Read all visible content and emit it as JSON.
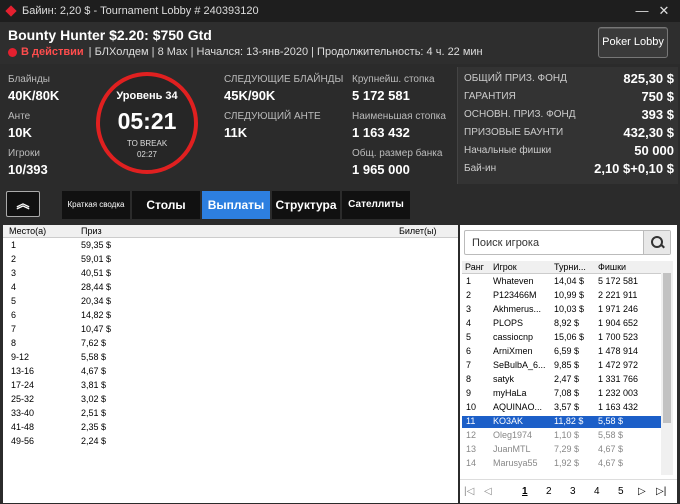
{
  "window": {
    "title": "Байин: 2,20 $ - Tournament Lobby # 240393120",
    "minimize": "—",
    "close": "✕"
  },
  "header": {
    "tournament_name": "Bounty Hunter $2.20: $750 Gtd",
    "status": "В действии",
    "info": "| БЛХолдем | 8 Max | Начался: 13-янв-2020 | Продолжительность: 4 ч. 22 мин",
    "poker_lobby_btn": "Poker Lobby"
  },
  "summary": {
    "blinds_label": "Блайнды",
    "blinds": "40K/80K",
    "ante_label": "Анте",
    "ante": "10K",
    "players_label": "Игроки",
    "players": "10/393",
    "next_blinds_label": "СЛЕДУЮЩИЕ БЛАЙНДЫ",
    "next_blinds": "45K/90K",
    "next_ante_label": "СЛЕДУЮЩИЙ АНТЕ",
    "next_ante": "11K",
    "largest_stack_label": "Крупнейш. стопка",
    "largest_stack": "5 172 581",
    "smallest_stack_label": "Наименьшая стопка",
    "smallest_stack": "1 163 432",
    "total_bank_label": "Общ. размер банка",
    "total_bank": "1 965 000"
  },
  "clock": {
    "level": "Уровень 34",
    "time": "05:21",
    "to_break": "TO BREAK",
    "break_time": "02:27"
  },
  "prize_panel": [
    {
      "label": "ОБЩИЙ ПРИЗ. ФОНД",
      "value": "825,30 $"
    },
    {
      "label": "ГАРАНТИЯ",
      "value": "750 $"
    },
    {
      "label": "ОСНОВН. ПРИЗ. ФОНД",
      "value": "393 $"
    },
    {
      "label": "ПРИЗОВЫЕ БАУНТИ",
      "value": "432,30 $"
    },
    {
      "label": "Начальные фишки",
      "value": "50 000"
    },
    {
      "label": "Бай-ин",
      "value": "2,10 $+0,10 $"
    }
  ],
  "tabs": {
    "collapse": "︽",
    "summary": "Краткая сводка",
    "tables": "Столы",
    "payouts": "Выплаты",
    "structure": "Структура",
    "satellites": "Сателлиты"
  },
  "payouts": {
    "headers": {
      "place": "Место(а)",
      "prize": "Приз",
      "ticket": "Билет(ы)"
    },
    "rows": [
      {
        "place": "1",
        "prize": "59,35 $"
      },
      {
        "place": "2",
        "prize": "59,01 $"
      },
      {
        "place": "3",
        "prize": "40,51 $"
      },
      {
        "place": "4",
        "prize": "28,44 $"
      },
      {
        "place": "5",
        "prize": "20,34 $"
      },
      {
        "place": "6",
        "prize": "14,82 $"
      },
      {
        "place": "7",
        "prize": "10,47 $"
      },
      {
        "place": "8",
        "prize": "7,62 $"
      },
      {
        "place": "9-12",
        "prize": "5,58 $"
      },
      {
        "place": "13-16",
        "prize": "4,67 $"
      },
      {
        "place": "17-24",
        "prize": "3,81 $"
      },
      {
        "place": "25-32",
        "prize": "3,02 $"
      },
      {
        "place": "33-40",
        "prize": "2,51 $"
      },
      {
        "place": "41-48",
        "prize": "2,35 $"
      },
      {
        "place": "49-56",
        "prize": "2,24 $"
      }
    ]
  },
  "players": {
    "search_placeholder": "Поиск игрока",
    "headers": {
      "rank": "Ранг",
      "player": "Игрок",
      "tourney": "Турни...",
      "chips": "Фишки"
    },
    "rows": [
      {
        "rank": "1",
        "player": "Whateven",
        "tourney": "14,04 $",
        "chips": "5 172 581"
      },
      {
        "rank": "2",
        "player": "P123466M",
        "tourney": "10,99 $",
        "chips": "2 221 911"
      },
      {
        "rank": "3",
        "player": "Akhmerus...",
        "tourney": "10,03 $",
        "chips": "1 971 246"
      },
      {
        "rank": "4",
        "player": "PLOPS",
        "tourney": "8,92 $",
        "chips": "1 904 652"
      },
      {
        "rank": "5",
        "player": "cassiocnp",
        "tourney": "15,06 $",
        "chips": "1 700 523"
      },
      {
        "rank": "6",
        "player": "ArniXmen",
        "tourney": "6,59 $",
        "chips": "1 478 914"
      },
      {
        "rank": "7",
        "player": "SeBulbA_6...",
        "tourney": "9,85 $",
        "chips": "1 472 972"
      },
      {
        "rank": "8",
        "player": "satyk",
        "tourney": "2,47 $",
        "chips": "1 331 766"
      },
      {
        "rank": "9",
        "player": "myHaLa",
        "tourney": "7,08 $",
        "chips": "1 232 003"
      },
      {
        "rank": "10",
        "player": "AQUINAO...",
        "tourney": "3,57 $",
        "chips": "1 163 432"
      },
      {
        "rank": "11",
        "player": "KO3AK",
        "tourney": "11,82 $",
        "chips": "5,58 $"
      },
      {
        "rank": "12",
        "player": "Oleg1974",
        "tourney": "1,10 $",
        "chips": "5,58 $"
      },
      {
        "rank": "13",
        "player": "JuanMTL",
        "tourney": "7,29 $",
        "chips": "4,67 $"
      },
      {
        "rank": "14",
        "player": "Marusya55",
        "tourney": "1,92 $",
        "chips": "4,67 $"
      }
    ],
    "pager": {
      "first": "|◁",
      "prev": "◁",
      "p1": "1",
      "p2": "2",
      "p3": "3",
      "p4": "4",
      "p5": "5",
      "next": "▷",
      "last": "▷|"
    }
  }
}
